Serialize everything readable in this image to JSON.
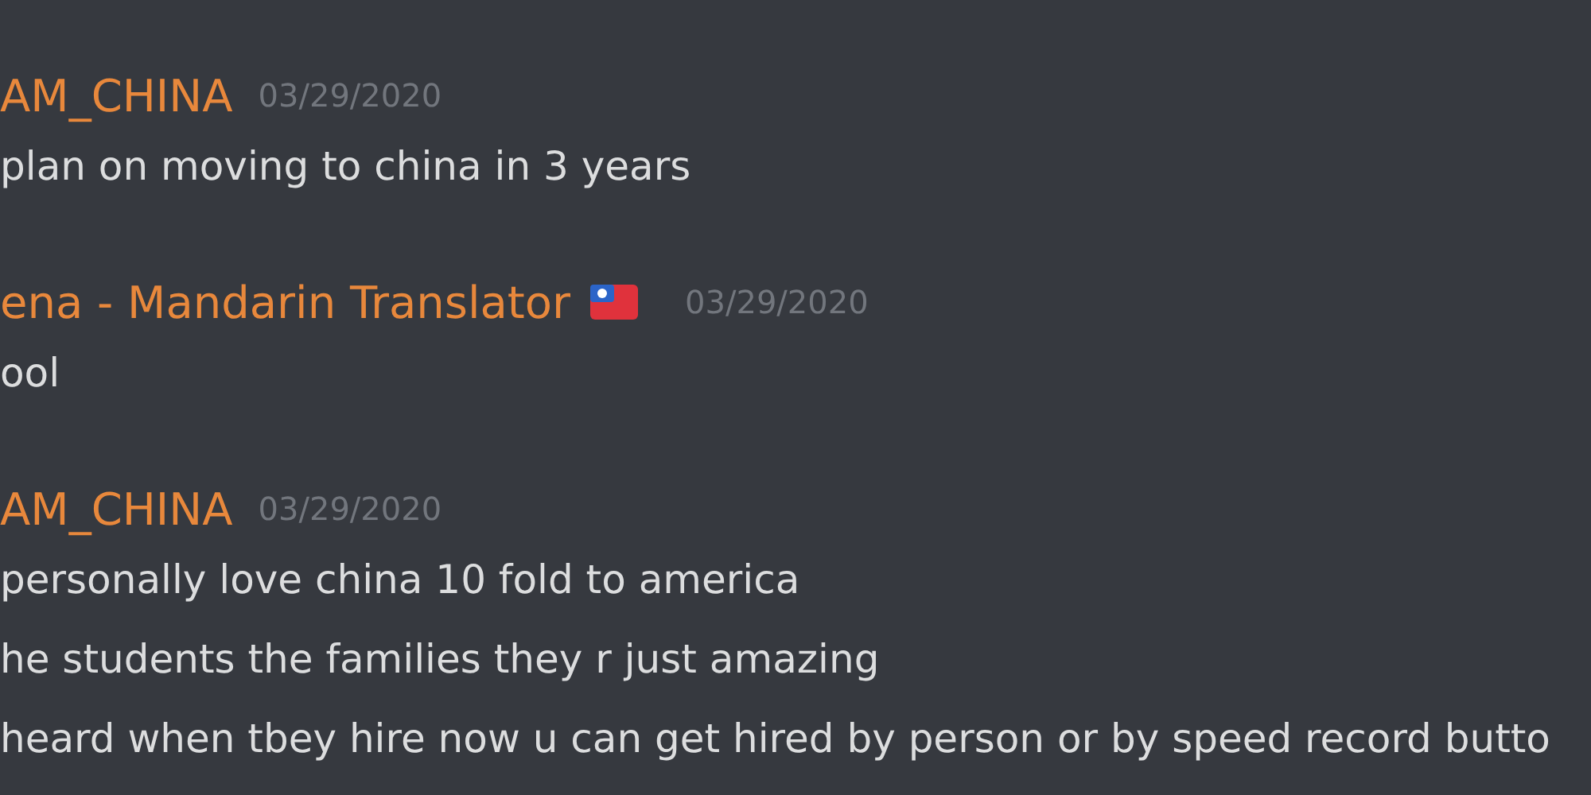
{
  "messages": [
    {
      "author": "AM_CHINA",
      "flag": false,
      "timestamp": "03/29/2020",
      "lines": [
        "plan on moving to china in 3 years"
      ]
    },
    {
      "author": "ena - Mandarin Translator",
      "flag": true,
      "timestamp": "03/29/2020",
      "lines": [
        "ool"
      ]
    },
    {
      "author": "AM_CHINA",
      "flag": false,
      "timestamp": "03/29/2020",
      "lines": [
        "personally love china 10 fold to america",
        "he students the families they r just amazing",
        "heard when tbey hire now u can get hired by person or by speed record butto"
      ]
    }
  ]
}
